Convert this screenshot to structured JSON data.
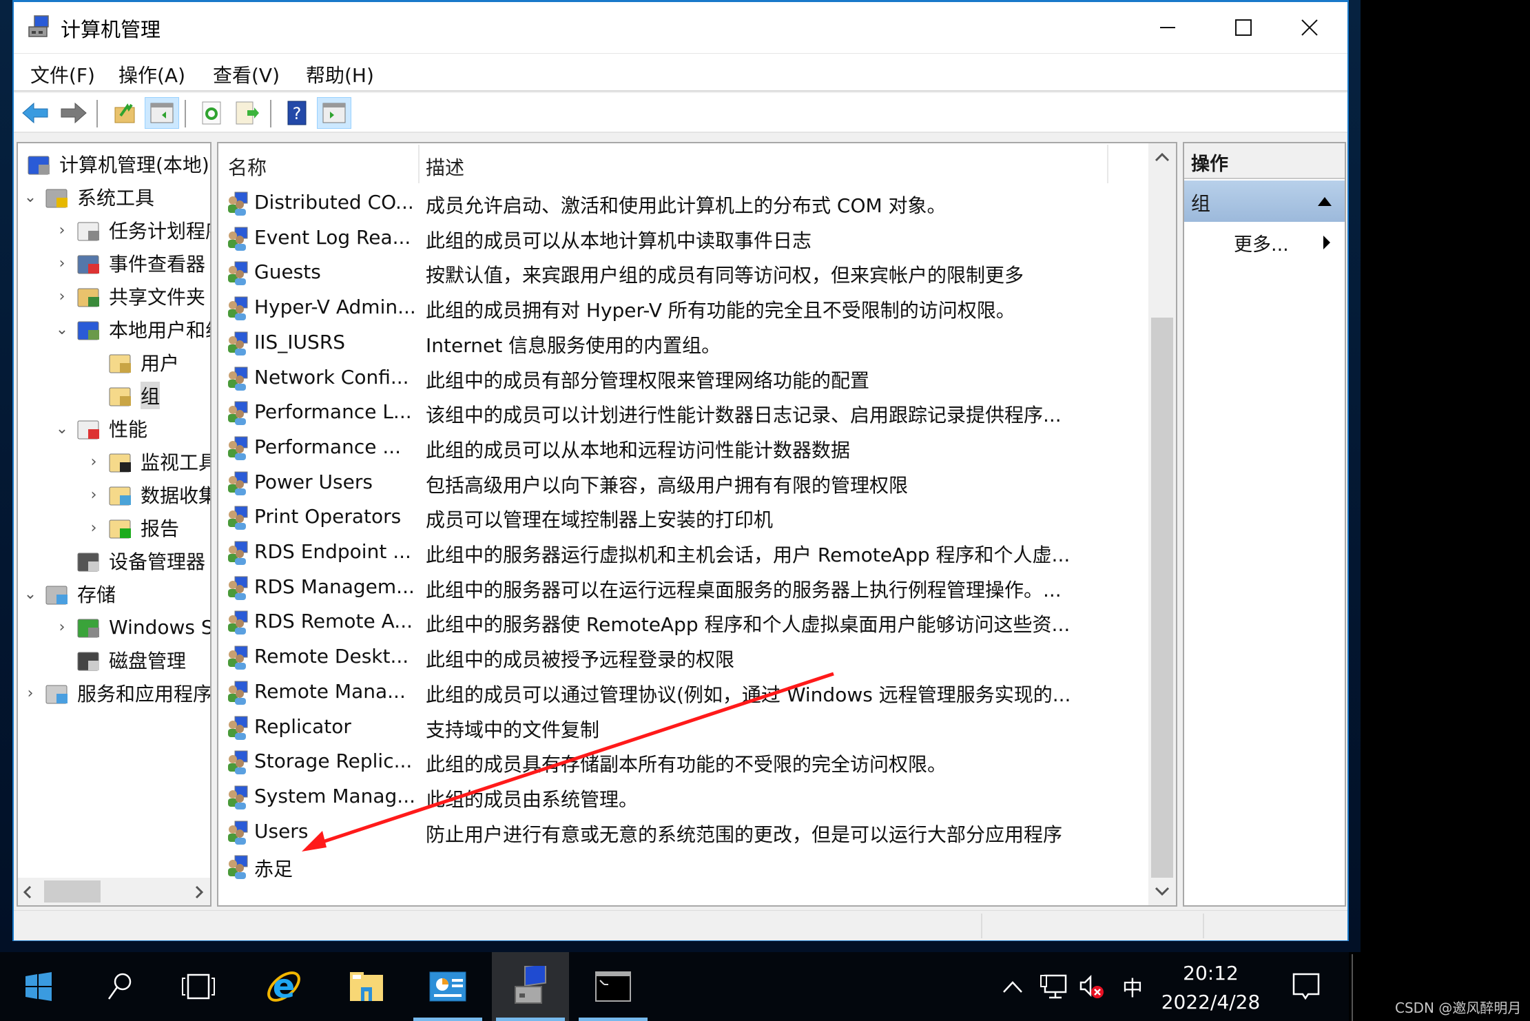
{
  "window": {
    "title": "计算机管理",
    "controls": {
      "minimize": "minimize",
      "maximize": "maximize",
      "close": "close"
    }
  },
  "menu": [
    {
      "label": "文件(F)"
    },
    {
      "label": "操作(A)"
    },
    {
      "label": "查看(V)"
    },
    {
      "label": "帮助(H)"
    }
  ],
  "toolbar": {
    "buttons": [
      {
        "name": "back",
        "icon": "back-arrow-icon"
      },
      {
        "name": "forward",
        "icon": "forward-arrow-icon"
      },
      {
        "name": "up-one-level",
        "icon": "up-folder-icon"
      },
      {
        "name": "show-hide-console-tree",
        "icon": "console-tree-icon",
        "active": true
      },
      {
        "name": "refresh",
        "icon": "refresh-icon"
      },
      {
        "name": "export-list",
        "icon": "export-list-icon"
      },
      {
        "name": "help",
        "icon": "help-icon"
      },
      {
        "name": "show-hide-action-pane",
        "icon": "action-pane-icon",
        "active": true
      }
    ]
  },
  "tree": {
    "items": [
      {
        "label": "计算机管理(本地)",
        "level": 0,
        "expander": "",
        "icon": "computer-management-icon"
      },
      {
        "label": "系统工具",
        "level": 1,
        "expander": "expanded",
        "icon": "tools-icon"
      },
      {
        "label": "任务计划程序",
        "level": 2,
        "expander": "collapsed",
        "icon": "clock-icon"
      },
      {
        "label": "事件查看器",
        "level": 2,
        "expander": "collapsed",
        "icon": "event-viewer-icon"
      },
      {
        "label": "共享文件夹",
        "level": 2,
        "expander": "collapsed",
        "icon": "shared-folder-icon"
      },
      {
        "label": "本地用户和组",
        "level": 2,
        "expander": "expanded",
        "icon": "users-icon"
      },
      {
        "label": "用户",
        "level": 3,
        "expander": "",
        "icon": "folder-icon"
      },
      {
        "label": "组",
        "level": 3,
        "expander": "",
        "icon": "folder-icon",
        "selected": true
      },
      {
        "label": "性能",
        "level": 2,
        "expander": "expanded",
        "icon": "performance-icon"
      },
      {
        "label": "监视工具",
        "level": 3,
        "expander": "collapsed",
        "icon": "monitor-folder-icon"
      },
      {
        "label": "数据收集器集",
        "level": 3,
        "expander": "collapsed",
        "icon": "data-collector-icon"
      },
      {
        "label": "报告",
        "level": 3,
        "expander": "collapsed",
        "icon": "report-icon"
      },
      {
        "label": "设备管理器",
        "level": 2,
        "expander": "",
        "icon": "device-manager-icon"
      },
      {
        "label": "存储",
        "level": 1,
        "expander": "expanded",
        "icon": "storage-icon"
      },
      {
        "label": "Windows Server Backup",
        "level": 2,
        "expander": "collapsed",
        "icon": "backup-icon"
      },
      {
        "label": "磁盘管理",
        "level": 2,
        "expander": "",
        "icon": "disk-icon"
      },
      {
        "label": "服务和应用程序",
        "level": 1,
        "expander": "collapsed",
        "icon": "services-icon"
      }
    ]
  },
  "list": {
    "columns": [
      "名称",
      "描述"
    ],
    "rows": [
      {
        "name": "Distributed CO...",
        "desc": "成员允许启动、激活和使用此计算机上的分布式 COM 对象。"
      },
      {
        "name": "Event Log Rea...",
        "desc": "此组的成员可以从本地计算机中读取事件日志"
      },
      {
        "name": "Guests",
        "desc": "按默认值，来宾跟用户组的成员有同等访问权，但来宾帐户的限制更多"
      },
      {
        "name": "Hyper-V Admin...",
        "desc": "此组的成员拥有对 Hyper-V 所有功能的完全且不受限制的访问权限。"
      },
      {
        "name": "IIS_IUSRS",
        "desc": "Internet 信息服务使用的内置组。"
      },
      {
        "name": "Network Confi...",
        "desc": "此组中的成员有部分管理权限来管理网络功能的配置"
      },
      {
        "name": "Performance L...",
        "desc": "该组中的成员可以计划进行性能计数器日志记录、启用跟踪记录提供程序..."
      },
      {
        "name": "Performance ...",
        "desc": "此组的成员可以从本地和远程访问性能计数器数据"
      },
      {
        "name": "Power Users",
        "desc": "包括高级用户以向下兼容，高级用户拥有有限的管理权限"
      },
      {
        "name": "Print Operators",
        "desc": "成员可以管理在域控制器上安装的打印机"
      },
      {
        "name": "RDS Endpoint ...",
        "desc": "此组中的服务器运行虚拟机和主机会话，用户 RemoteApp 程序和个人虚..."
      },
      {
        "name": "RDS Managem...",
        "desc": "此组中的服务器可以在运行远程桌面服务的服务器上执行例程管理操作。..."
      },
      {
        "name": "RDS Remote A...",
        "desc": "此组中的服务器使 RemoteApp 程序和个人虚拟桌面用户能够访问这些资..."
      },
      {
        "name": "Remote Deskt...",
        "desc": "此组中的成员被授予远程登录的权限"
      },
      {
        "name": "Remote Mana...",
        "desc": "此组的成员可以通过管理协议(例如，通过 Windows 远程管理服务实现的..."
      },
      {
        "name": "Replicator",
        "desc": "支持域中的文件复制"
      },
      {
        "name": "Storage Replic...",
        "desc": "此组的成员具有存储副本所有功能的不受限的完全访问权限。"
      },
      {
        "name": "System Manag...",
        "desc": "此组的成员由系统管理。"
      },
      {
        "name": "Users",
        "desc": "防止用户进行有意或无意的系统范围的更改，但是可以运行大部分应用程序"
      },
      {
        "name": "赤足",
        "desc": ""
      }
    ]
  },
  "actions": {
    "header": "操作",
    "group": "组",
    "more": "更多..."
  },
  "annotation": {
    "color": "#ff1a1a",
    "target": "赤足"
  },
  "taskbar": {
    "apps": [
      {
        "name": "start",
        "icon": "windows-start-icon"
      },
      {
        "name": "search",
        "icon": "search-icon"
      },
      {
        "name": "task-view",
        "icon": "task-view-icon"
      },
      {
        "name": "internet-explorer",
        "icon": "ie-icon"
      },
      {
        "name": "file-explorer",
        "icon": "file-explorer-icon"
      },
      {
        "name": "server-manager",
        "icon": "server-manager-icon",
        "running": true
      },
      {
        "name": "computer-management",
        "icon": "computer-management-icon",
        "running": true,
        "active": true
      },
      {
        "name": "command-prompt",
        "icon": "cmd-icon",
        "running": true
      }
    ],
    "tray": {
      "ime": "中",
      "time": "20:12",
      "date": "2022/4/28"
    }
  },
  "watermark": "CSDN @邀风醉明月",
  "colors": {
    "accent": "#1979ca",
    "selection": "#d9d9d9",
    "action_group": "#b8d0ea",
    "taskbar": "#03070d",
    "running_indicator": "#76b9ed"
  }
}
